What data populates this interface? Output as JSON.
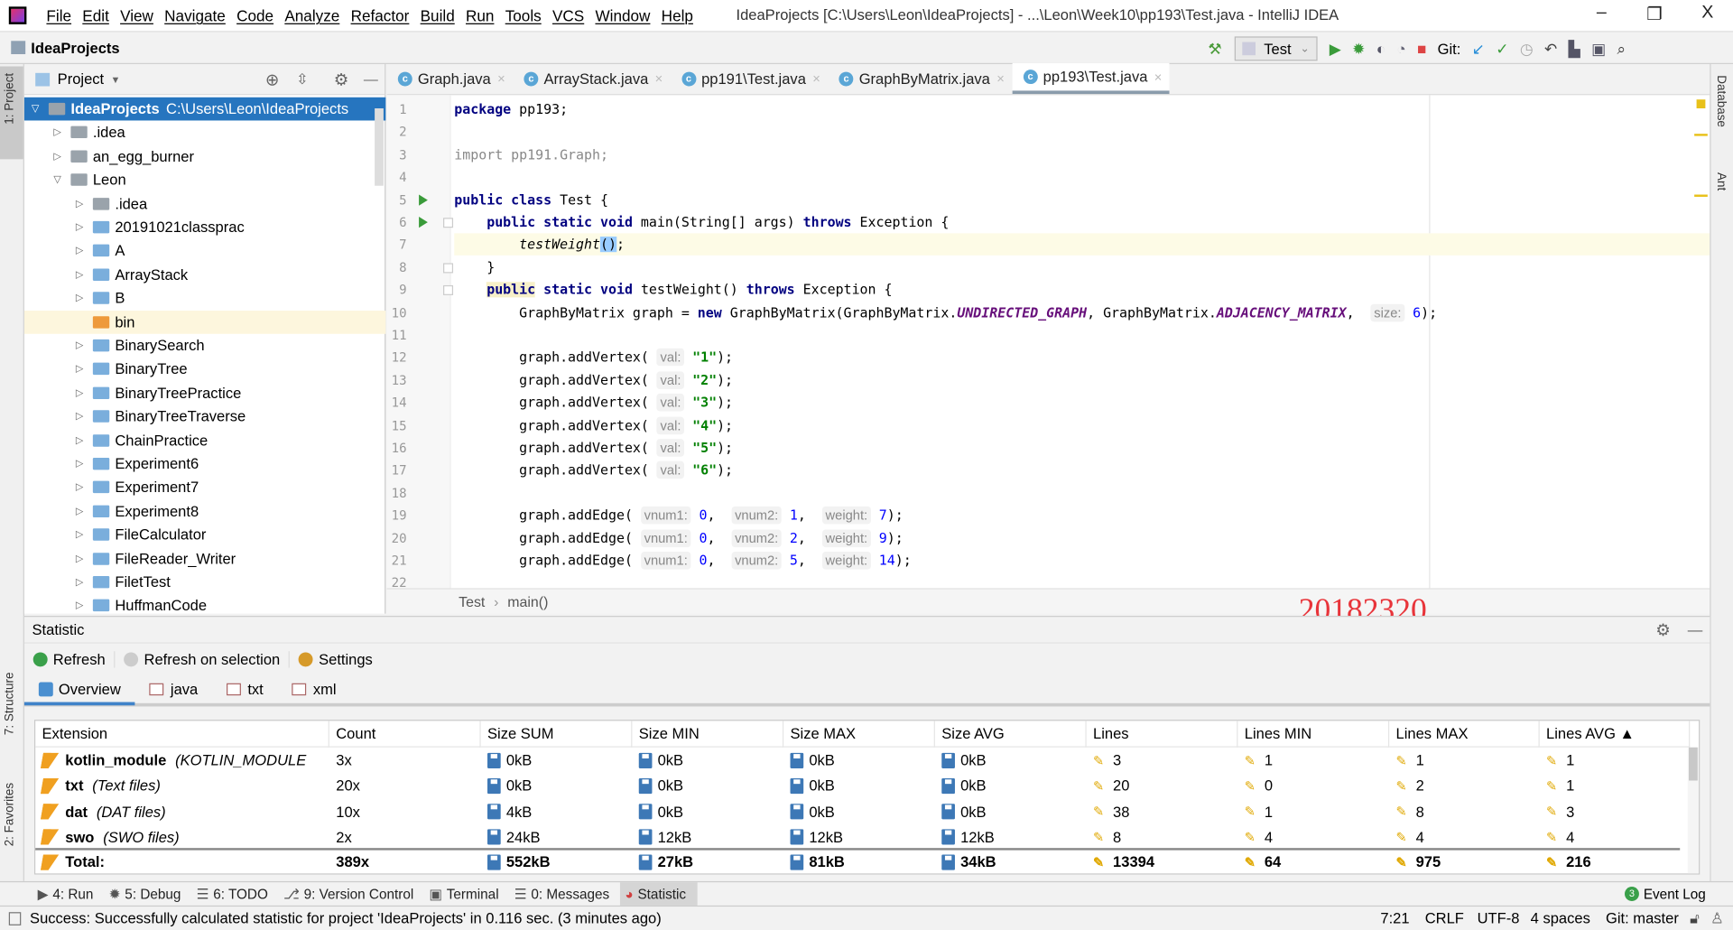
{
  "titlebar": {
    "menu": [
      "File",
      "Edit",
      "View",
      "Navigate",
      "Code",
      "Analyze",
      "Refactor",
      "Build",
      "Run",
      "Tools",
      "VCS",
      "Window",
      "Help"
    ],
    "title": "IdeaProjects [C:\\Users\\Leon\\IdeaProjects] - ...\\Leon\\Week10\\pp193\\Test.java - IntelliJ IDEA",
    "minimize": "–",
    "restore": "❐",
    "close": "X"
  },
  "toolbar": {
    "project": "IdeaProjects",
    "run_config": "Test",
    "git_label": "Git:"
  },
  "left_strip": {
    "project": "1: Project",
    "structure": "7: Structure",
    "favorites": "2: Favorites"
  },
  "right_strip": {
    "database": "Database",
    "ant": "Ant"
  },
  "project_panel": {
    "title": "Project",
    "items": [
      {
        "label": "IdeaProjects",
        "path": "C:\\Users\\Leon\\IdeaProjects",
        "depth": 0,
        "expanded": true,
        "selected": true,
        "folder": "grey"
      },
      {
        "label": ".idea",
        "depth": 1,
        "expanded": false,
        "folder": "grey"
      },
      {
        "label": "an_egg_burner",
        "depth": 1,
        "expanded": false,
        "folder": "grey"
      },
      {
        "label": "Leon",
        "depth": 1,
        "expanded": true,
        "folder": "grey"
      },
      {
        "label": ".idea",
        "depth": 2,
        "expanded": false,
        "folder": "grey"
      },
      {
        "label": "20191021classprac",
        "depth": 2,
        "expanded": false,
        "folder": "blue"
      },
      {
        "label": "A",
        "depth": 2,
        "expanded": false,
        "folder": "blue"
      },
      {
        "label": "ArrayStack",
        "depth": 2,
        "expanded": false,
        "folder": "blue"
      },
      {
        "label": "B",
        "depth": 2,
        "expanded": false,
        "folder": "blue"
      },
      {
        "label": "bin",
        "depth": 2,
        "leaf": true,
        "highlight": true,
        "folder": "orange"
      },
      {
        "label": "BinarySearch",
        "depth": 2,
        "expanded": false,
        "folder": "blue"
      },
      {
        "label": "BinaryTree",
        "depth": 2,
        "expanded": false,
        "folder": "blue"
      },
      {
        "label": "BinaryTreePractice",
        "depth": 2,
        "expanded": false,
        "folder": "blue"
      },
      {
        "label": "BinaryTreeTraverse",
        "depth": 2,
        "expanded": false,
        "folder": "blue"
      },
      {
        "label": "ChainPractice",
        "depth": 2,
        "expanded": false,
        "folder": "blue"
      },
      {
        "label": "Experiment6",
        "depth": 2,
        "expanded": false,
        "folder": "blue"
      },
      {
        "label": "Experiment7",
        "depth": 2,
        "expanded": false,
        "folder": "blue"
      },
      {
        "label": "Experiment8",
        "depth": 2,
        "expanded": false,
        "folder": "blue"
      },
      {
        "label": "FileCalculator",
        "depth": 2,
        "expanded": false,
        "folder": "blue"
      },
      {
        "label": "FileReader_Writer",
        "depth": 2,
        "expanded": false,
        "folder": "blue"
      },
      {
        "label": "FiletTest",
        "depth": 2,
        "expanded": false,
        "folder": "blue"
      },
      {
        "label": "HuffmanCode",
        "depth": 2,
        "expanded": false,
        "folder": "blue"
      }
    ]
  },
  "editor": {
    "tabs": [
      {
        "label": "Graph.java"
      },
      {
        "label": "ArrayStack.java"
      },
      {
        "label": "pp191\\Test.java"
      },
      {
        "label": "GraphByMatrix.java"
      },
      {
        "label": "pp193\\Test.java",
        "active": true
      }
    ],
    "current_line": 7,
    "lines": [
      [
        [
          "kw",
          "package"
        ],
        [
          "p",
          " pp193;"
        ]
      ],
      [],
      [
        [
          "imp",
          "import pp191.Graph;"
        ]
      ],
      [],
      [
        [
          "kw",
          "public class"
        ],
        [
          "p",
          " Test {"
        ]
      ],
      [
        [
          "p",
          "    "
        ],
        [
          "kw",
          "public static void"
        ],
        [
          "p",
          " main(String[] args) "
        ],
        [
          "kw",
          "throws"
        ],
        [
          "p",
          " Exception {"
        ]
      ],
      [
        [
          "p",
          "        "
        ],
        [
          "it",
          "testWeight"
        ],
        [
          "brk",
          "()"
        ],
        [
          "p",
          ";"
        ]
      ],
      [
        [
          "p",
          "    }"
        ]
      ],
      [
        [
          "p",
          "    "
        ],
        [
          "kwhl",
          "public"
        ],
        [
          "kw",
          " static void"
        ],
        [
          "p",
          " testWeight() "
        ],
        [
          "kw",
          "throws"
        ],
        [
          "p",
          " Exception {"
        ]
      ],
      [
        [
          "p",
          "        GraphByMatrix graph = "
        ],
        [
          "kw",
          "new"
        ],
        [
          "p",
          " GraphByMatrix(GraphByMatrix."
        ],
        [
          "cst",
          "UNDIRECTED_GRAPH"
        ],
        [
          "p",
          ", GraphByMatrix."
        ],
        [
          "cst",
          "ADJACENCY_MATRIX"
        ],
        [
          "p",
          ",  "
        ],
        [
          "hint",
          "size:"
        ],
        [
          "p",
          " "
        ],
        [
          "num",
          "6"
        ],
        [
          "p",
          ");"
        ]
      ],
      [],
      [
        [
          "p",
          "        graph.addVertex( "
        ],
        [
          "hint",
          "val:"
        ],
        [
          "p",
          " "
        ],
        [
          "str",
          "\"1\""
        ],
        [
          "p",
          ");"
        ]
      ],
      [
        [
          "p",
          "        graph.addVertex( "
        ],
        [
          "hint",
          "val:"
        ],
        [
          "p",
          " "
        ],
        [
          "str",
          "\"2\""
        ],
        [
          "p",
          ");"
        ]
      ],
      [
        [
          "p",
          "        graph.addVertex( "
        ],
        [
          "hint",
          "val:"
        ],
        [
          "p",
          " "
        ],
        [
          "str",
          "\"3\""
        ],
        [
          "p",
          ");"
        ]
      ],
      [
        [
          "p",
          "        graph.addVertex( "
        ],
        [
          "hint",
          "val:"
        ],
        [
          "p",
          " "
        ],
        [
          "str",
          "\"4\""
        ],
        [
          "p",
          ");"
        ]
      ],
      [
        [
          "p",
          "        graph.addVertex( "
        ],
        [
          "hint",
          "val:"
        ],
        [
          "p",
          " "
        ],
        [
          "str",
          "\"5\""
        ],
        [
          "p",
          ");"
        ]
      ],
      [
        [
          "p",
          "        graph.addVertex( "
        ],
        [
          "hint",
          "val:"
        ],
        [
          "p",
          " "
        ],
        [
          "str",
          "\"6\""
        ],
        [
          "p",
          ");"
        ]
      ],
      [],
      [
        [
          "p",
          "        graph.addEdge( "
        ],
        [
          "hint",
          "vnum1:"
        ],
        [
          "p",
          " "
        ],
        [
          "num",
          "0"
        ],
        [
          "p",
          ",  "
        ],
        [
          "hint",
          "vnum2:"
        ],
        [
          "p",
          " "
        ],
        [
          "num",
          "1"
        ],
        [
          "p",
          ",  "
        ],
        [
          "hint",
          "weight:"
        ],
        [
          "p",
          " "
        ],
        [
          "num",
          "7"
        ],
        [
          "p",
          ");"
        ]
      ],
      [
        [
          "p",
          "        graph.addEdge( "
        ],
        [
          "hint",
          "vnum1:"
        ],
        [
          "p",
          " "
        ],
        [
          "num",
          "0"
        ],
        [
          "p",
          ",  "
        ],
        [
          "hint",
          "vnum2:"
        ],
        [
          "p",
          " "
        ],
        [
          "num",
          "2"
        ],
        [
          "p",
          ",  "
        ],
        [
          "hint",
          "weight:"
        ],
        [
          "p",
          " "
        ],
        [
          "num",
          "9"
        ],
        [
          "p",
          ");"
        ]
      ],
      [
        [
          "p",
          "        graph.addEdge( "
        ],
        [
          "hint",
          "vnum1:"
        ],
        [
          "p",
          " "
        ],
        [
          "num",
          "0"
        ],
        [
          "p",
          ",  "
        ],
        [
          "hint",
          "vnum2:"
        ],
        [
          "p",
          " "
        ],
        [
          "num",
          "5"
        ],
        [
          "p",
          ",  "
        ],
        [
          "hint",
          "weight:"
        ],
        [
          "p",
          " "
        ],
        [
          "num",
          "14"
        ],
        [
          "p",
          ");"
        ]
      ],
      []
    ],
    "breadcrumb": [
      "Test",
      "main()"
    ],
    "breadcrumb_sep": "›"
  },
  "watermark": "20182320",
  "statistic": {
    "title": "Statistic",
    "tools": [
      "Refresh",
      "Refresh on selection",
      "Settings"
    ],
    "tabs": [
      {
        "label": "Overview",
        "active": true
      },
      {
        "label": "java"
      },
      {
        "label": "txt"
      },
      {
        "label": "xml"
      }
    ],
    "columns": [
      "Extension",
      "Count",
      "Size SUM",
      "Size MIN",
      "Size MAX",
      "Size AVG",
      "Lines",
      "Lines MIN",
      "Lines MAX",
      "Lines AVG ▲"
    ],
    "rows": [
      {
        "ext": "kotlin_module",
        "desc": "(KOTLIN_MODULE",
        "count": "3x",
        "sizes": [
          "0kB",
          "0kB",
          "0kB",
          "0kB"
        ],
        "lines": [
          "3",
          "1",
          "1",
          "1"
        ]
      },
      {
        "ext": "txt",
        "desc": "(Text files)",
        "count": "20x",
        "sizes": [
          "0kB",
          "0kB",
          "0kB",
          "0kB"
        ],
        "lines": [
          "20",
          "0",
          "2",
          "1"
        ]
      },
      {
        "ext": "dat",
        "desc": "(DAT files)",
        "count": "10x",
        "sizes": [
          "4kB",
          "0kB",
          "0kB",
          "0kB"
        ],
        "lines": [
          "38",
          "1",
          "8",
          "3"
        ]
      },
      {
        "ext": "swo",
        "desc": "(SWO files)",
        "count": "2x",
        "sizes": [
          "24kB",
          "12kB",
          "12kB",
          "12kB"
        ],
        "lines": [
          "8",
          "4",
          "4",
          "4"
        ]
      }
    ],
    "total": {
      "ext": "Total:",
      "count": "389x",
      "sizes": [
        "552kB",
        "27kB",
        "81kB",
        "34kB"
      ],
      "lines": [
        "13394",
        "64",
        "975",
        "216"
      ]
    }
  },
  "tool_windows": [
    "4: Run",
    "5: Debug",
    "6: TODO",
    "9: Version Control",
    "Terminal",
    "0: Messages",
    "Statistic"
  ],
  "event_log": {
    "label": "Event Log",
    "count": "3"
  },
  "status": {
    "message": "Success: Successfully calculated statistic for project 'IdeaProjects' in 0.116 sec. (3 minutes ago)",
    "position": "7:21",
    "line_sep": "CRLF",
    "encoding": "UTF-8",
    "indent": "4 spaces",
    "git": "Git: master"
  }
}
